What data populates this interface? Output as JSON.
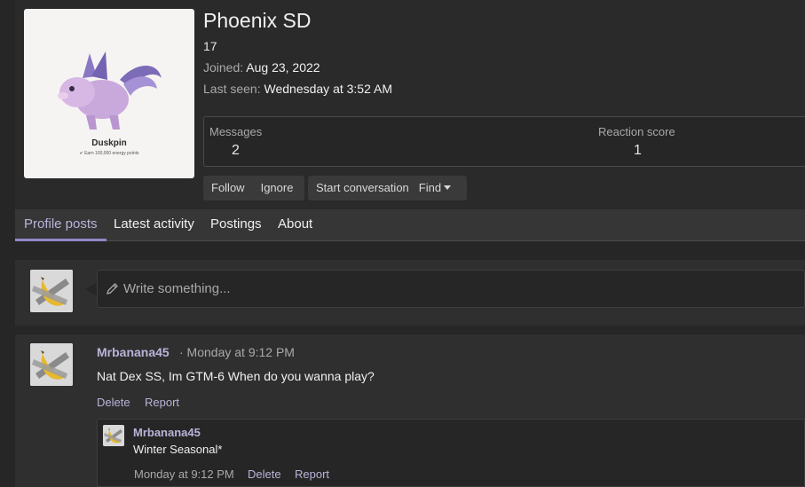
{
  "profile": {
    "name": "Phoenix SD",
    "title": "17",
    "joined_label": "Joined:",
    "joined_value": "Aug 23, 2022",
    "last_seen_label": "Last seen:",
    "last_seen_value": "Wednesday at 3:52 AM",
    "avatar_pet_name": "Duskpin",
    "avatar_pet_sub": "✔ Earn 100,000 energy points"
  },
  "stats": {
    "messages_label": "Messages",
    "messages_value": "2",
    "reaction_label": "Reaction score",
    "reaction_value": "1"
  },
  "actions": {
    "follow": "Follow",
    "ignore": "Ignore",
    "start_conversation": "Start conversation",
    "find": "Find"
  },
  "tabs": [
    {
      "label": "Profile posts",
      "active": true
    },
    {
      "label": "Latest activity"
    },
    {
      "label": "Postings"
    },
    {
      "label": "About"
    }
  ],
  "compose": {
    "placeholder": "Write something..."
  },
  "post": {
    "author": "Mrbanana45",
    "time": "· Monday at 9:12 PM",
    "body": "Nat Dex SS, Im GTM-6 When do you wanna play?",
    "delete": "Delete",
    "report": "Report"
  },
  "reply": {
    "author": "Mrbanana45",
    "body": "Winter Seasonal*",
    "time": "Monday at 9:12 PM",
    "delete": "Delete",
    "report": "Report"
  },
  "colors": {
    "accent": "#b8b4d9",
    "tab_underline": "#8e89c4",
    "background": "#262626"
  }
}
